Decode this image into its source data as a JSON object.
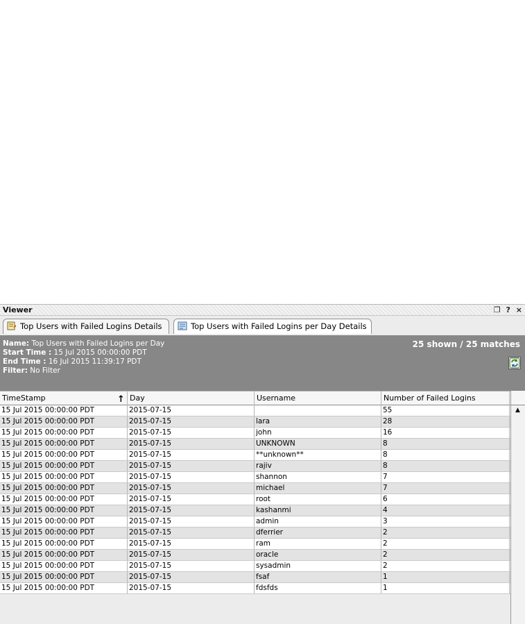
{
  "viewer": {
    "title": "Viewer",
    "controls": [
      "❐",
      "?",
      "×"
    ]
  },
  "tabs": [
    {
      "label": "Top Users with Failed Logins Details",
      "icon": "report-icon",
      "active": false
    },
    {
      "label": "Top Users with Failed Logins per Day Details",
      "icon": "report-details-icon",
      "active": true
    }
  ],
  "info": {
    "name_label": "Name:",
    "name_value": "Top Users with Failed Logins per Day",
    "start_label": "Start Time :",
    "start_value": "15 Jul 2015 00:00:00 PDT",
    "end_label": "End Time :",
    "end_value": "16 Jul 2015 11:39:17 PDT",
    "filter_label": "Filter:",
    "filter_value": "No Filter",
    "matches": "25 shown / 25 matches",
    "refresh_icon": "refresh-icon"
  },
  "table": {
    "columns": [
      "TimeStamp",
      "Day",
      "Username",
      "Number of Failed Logins"
    ],
    "sort_indicator": "↑",
    "rows": [
      [
        "15 Jul 2015 00:00:00 PDT",
        "2015-07-15",
        "",
        "55"
      ],
      [
        "15 Jul 2015 00:00:00 PDT",
        "2015-07-15",
        "lara",
        "28"
      ],
      [
        "15 Jul 2015 00:00:00 PDT",
        "2015-07-15",
        "john",
        "16"
      ],
      [
        "15 Jul 2015 00:00:00 PDT",
        "2015-07-15",
        "UNKNOWN",
        "8"
      ],
      [
        "15 Jul 2015 00:00:00 PDT",
        "2015-07-15",
        "**unknown**",
        "8"
      ],
      [
        "15 Jul 2015 00:00:00 PDT",
        "2015-07-15",
        "rajiv",
        "8"
      ],
      [
        "15 Jul 2015 00:00:00 PDT",
        "2015-07-15",
        "shannon",
        "7"
      ],
      [
        "15 Jul 2015 00:00:00 PDT",
        "2015-07-15",
        "michael",
        "7"
      ],
      [
        "15 Jul 2015 00:00:00 PDT",
        "2015-07-15",
        "root",
        "6"
      ],
      [
        "15 Jul 2015 00:00:00 PDT",
        "2015-07-15",
        "kashanmi",
        "4"
      ],
      [
        "15 Jul 2015 00:00:00 PDT",
        "2015-07-15",
        "admin",
        "3"
      ],
      [
        "15 Jul 2015 00:00:00 PDT",
        "2015-07-15",
        "dferrier",
        "2"
      ],
      [
        "15 Jul 2015 00:00:00 PDT",
        "2015-07-15",
        "ram",
        "2"
      ],
      [
        "15 Jul 2015 00:00:00 PDT",
        "2015-07-15",
        "oracle",
        "2"
      ],
      [
        "15 Jul 2015 00:00:00 PDT",
        "2015-07-15",
        "sysadmin",
        "2"
      ],
      [
        "15 Jul 2015 00:00:00 PDT",
        "2015-07-15",
        "fsaf",
        "1"
      ],
      [
        "15 Jul 2015 00:00:00 PDT",
        "2015-07-15",
        "fdsfds",
        "1"
      ]
    ]
  },
  "scrollbar": {
    "up_arrow": "▲"
  }
}
